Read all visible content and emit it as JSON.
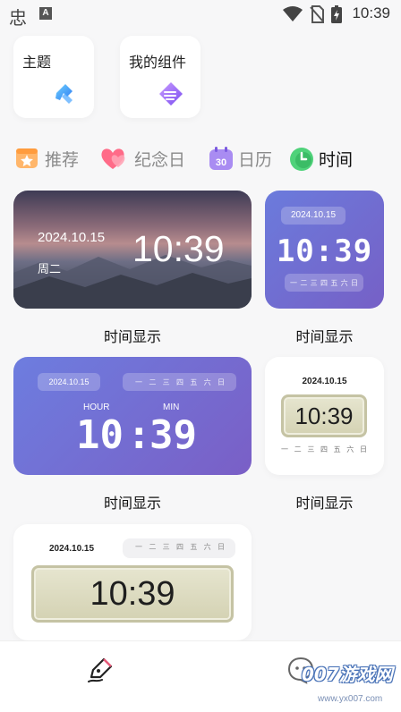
{
  "status_bar": {
    "time": "10:39",
    "app_glyph": "忠",
    "a_badge": "A"
  },
  "shortcuts": [
    {
      "label": "主题",
      "icon": "theme-brush-icon"
    },
    {
      "label": "我的组件",
      "icon": "widget-layers-icon"
    }
  ],
  "tabs": [
    {
      "label": "推荐",
      "icon": "star-icon",
      "active": false
    },
    {
      "label": "纪念日",
      "icon": "heart-icon",
      "active": false
    },
    {
      "label": "日历",
      "icon": "calendar-30-icon",
      "active": false,
      "icon_text": "30"
    },
    {
      "label": "时间",
      "icon": "clock-icon",
      "active": true
    }
  ],
  "widgets": {
    "landscape": {
      "date": "2024.10.15",
      "weekday": "周二",
      "time": "10:39",
      "caption": "时间显示"
    },
    "purple_small": {
      "date": "2024.10.15",
      "time": "10:39",
      "weekdays": [
        "一",
        "二",
        "三",
        "四",
        "五",
        "六",
        "日"
      ],
      "caption": "时间显示"
    },
    "purple_large": {
      "date": "2024.10.15",
      "hour_label": "HOUR",
      "min_label": "MIN",
      "hours": "10",
      "minutes": "39",
      "separator": ":",
      "weekdays": [
        "一",
        "二",
        "三",
        "四",
        "五",
        "六",
        "日"
      ],
      "caption": "时间显示"
    },
    "lcd_small": {
      "date": "2024.10.15",
      "time": "10:39",
      "weekdays": [
        "一",
        "二",
        "三",
        "四",
        "五",
        "六",
        "日"
      ],
      "caption": "时间显示"
    },
    "lcd_large": {
      "date": "2024.10.15",
      "time": "10:39",
      "weekdays": [
        "一",
        "二",
        "三",
        "四",
        "五",
        "六",
        "日"
      ]
    }
  },
  "watermark": {
    "main": "007游戏网",
    "sub": "www.yx007.com"
  },
  "colors": {
    "accent_purple": "#7066d0",
    "tab_active": "#111111",
    "tab_inactive": "#8a8a8a"
  }
}
